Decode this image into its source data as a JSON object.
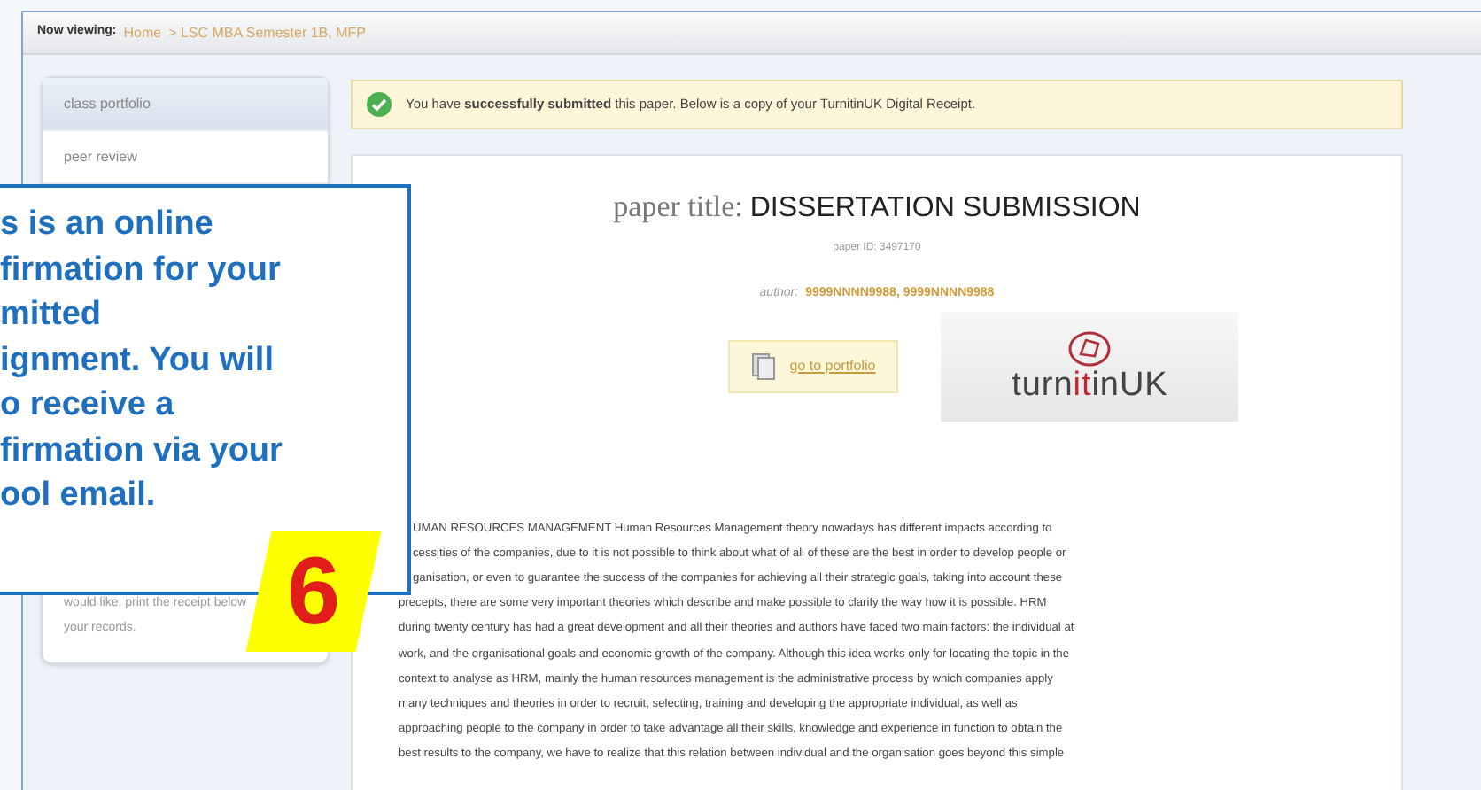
{
  "header": {
    "label": "Now viewing:",
    "breadcrumb": [
      {
        "text": "Home"
      },
      {
        "text": "> LSC MBA Semester 1B, MFP"
      }
    ]
  },
  "sidebar": {
    "items": [
      {
        "label": "class portfolio",
        "selected": true
      },
      {
        "label": "peer review",
        "selected": false
      }
    ],
    "note_lines": [
      "would like, print the receipt below",
      "your records."
    ]
  },
  "banner": {
    "text": "You have **successfully submitted** this paper. Below is a copy of your TurnitinUK Digital Receipt."
  },
  "receipt": {
    "title_label": "paper title:",
    "title": "DISSERTATION SUBMISSION",
    "paper_id": "paper ID: 3497170",
    "author_label": "author:",
    "author": "9999NNNN9988, 9999NNNN9988",
    "portfolio_link": "go to portfolio",
    "logo": {
      "prefix": "turn",
      "highlight": "it",
      "suffix": "inUK"
    },
    "body_lines": [
      "UMAN RESOURCES MANAGEMENT Human Resources Management theory nowadays has different impacts according to",
      "cessities of the companies, due to it is not possible to think about what of all of these are the best in order to develop people or",
      "ganisation, or even to guarantee the success of the companies for achieving all their strategic goals, taking into account these",
      "precepts, there are some very important theories which describe and make possible to clarify the way how it is possible. HRM",
      "during twenty century has had a great development and all their theories and authors have faced two main factors: the individual at",
      "work, and the organisational goals and economic growth of the company. Although this idea works only for locating the topic in the",
      "context to analyse as HRM, mainly the human resources management is the administrative process by which companies apply",
      "many techniques and theories in order to recruit, selecting, training and developing the appropriate individual, as well as",
      "approaching people to the company in order to take advantage all their skills, knowledge and experience in function to obtain the",
      "best results to the company, we have to realize that this relation between individual and the organisation goes beyond this simple"
    ]
  },
  "callout": {
    "lines": [
      "s is an online",
      "firmation for your",
      "mitted",
      "ignment. You will",
      "o receive a",
      "firmation via your",
      "ool email."
    ],
    "step": "6"
  }
}
